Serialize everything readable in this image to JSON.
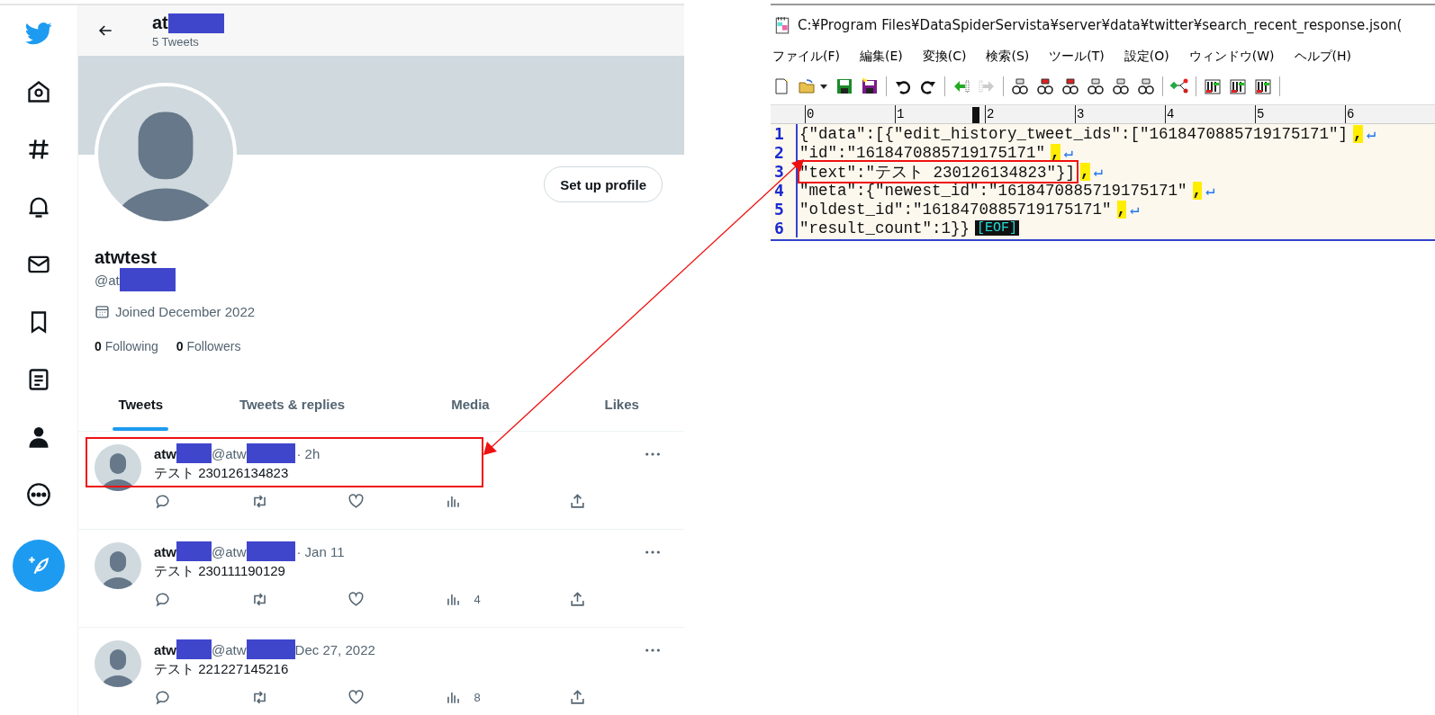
{
  "profile_header": {
    "name": "at",
    "name_redacted": true,
    "tweet_count": "5 Tweets"
  },
  "profile": {
    "button": "Set up profile",
    "display_name": "atwtest",
    "handle": "@at",
    "handle_redacted": true,
    "joined": "Joined December 2022",
    "following_count": "0",
    "following_label": "Following",
    "followers_count": "0",
    "followers_label": "Followers"
  },
  "tabs": [
    {
      "label": "Tweets",
      "selected": true
    },
    {
      "label": "Tweets & replies",
      "selected": false
    },
    {
      "label": "Media",
      "selected": false
    },
    {
      "label": "Likes",
      "selected": false
    }
  ],
  "tweets": [
    {
      "name": "atw",
      "handle": "@atw",
      "redacted": true,
      "separator": "·",
      "time": "2h",
      "text": "テスト 230126134823",
      "highlighted": true
    },
    {
      "name": "atw",
      "handle": "@atw",
      "redacted": true,
      "separator": "·",
      "time": "Jan 11",
      "text": "テスト 230111190129",
      "views": "4",
      "highlighted": false
    },
    {
      "name": "atw",
      "handle": "@atw",
      "redacted": true,
      "time": "Dec 27, 2022",
      "text": "テスト 221227145216",
      "views": "8",
      "highlighted": false
    }
  ],
  "editor": {
    "title": "C:¥Program Files¥DataSpiderServista¥server¥data¥twitter¥search_recent_response.json(",
    "menu": [
      "ファイル(F)",
      "編集(E)",
      "変換(C)",
      "検索(S)",
      "ツール(T)",
      "設定(O)",
      "ウィンドウ(W)",
      "ヘルプ(H)"
    ],
    "ruler": [
      "0",
      "1",
      "2",
      "3",
      "4",
      "5",
      "6"
    ],
    "lines": [
      {
        "number": "1",
        "text": "{\"data\":[{\"edit_history_tweet_ids\":[\"1618470885719175171\"]",
        "comma": ",",
        "end": {
          "kind": "newline",
          "text": "↵"
        },
        "highlighted": false
      },
      {
        "number": "2",
        "text": "\"id\":\"1618470885719175171\"",
        "comma": ",",
        "end": {
          "kind": "newline",
          "text": "↵"
        },
        "highlighted": false
      },
      {
        "number": "3",
        "text": "\"text\":\"テスト 230126134823\"}]",
        "comma": ",",
        "end": {
          "kind": "newline",
          "text": "↵"
        },
        "highlighted": true
      },
      {
        "number": "4",
        "text": "\"meta\":{\"newest_id\":\"1618470885719175171\"",
        "comma": ",",
        "end": {
          "kind": "newline",
          "text": "↵"
        },
        "highlighted": false
      },
      {
        "number": "5",
        "text": "\"oldest_id\":\"1618470885719175171\"",
        "comma": ",",
        "end": {
          "kind": "newline",
          "text": "↵"
        },
        "highlighted": false
      },
      {
        "number": "6",
        "text": "\"result_count\":1}}",
        "end": {
          "kind": "eof",
          "text": "[EOF]"
        },
        "highlighted": false
      }
    ]
  }
}
